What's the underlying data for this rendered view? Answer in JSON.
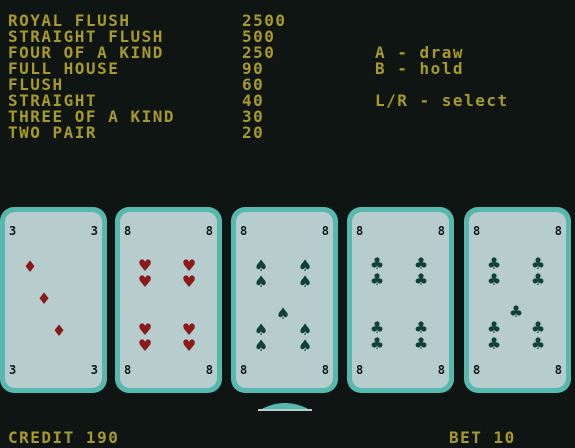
{
  "paytable": [
    {
      "hand": "ROYAL FLUSH",
      "payout": "2500"
    },
    {
      "hand": "STRAIGHT FLUSH",
      "payout": "500"
    },
    {
      "hand": "FOUR OF A KIND",
      "payout": "250"
    },
    {
      "hand": "FULL HOUSE",
      "payout": "90"
    },
    {
      "hand": "FLUSH",
      "payout": "60"
    },
    {
      "hand": "STRAIGHT",
      "payout": "40"
    },
    {
      "hand": "THREE OF A KIND",
      "payout": "30"
    },
    {
      "hand": "TWO PAIR",
      "payout": "20"
    }
  ],
  "controls": {
    "draw": "A - draw",
    "hold": "B - hold",
    "select": "L/R - select"
  },
  "cards": [
    {
      "rank": "3",
      "suit": "diamonds",
      "color": "red"
    },
    {
      "rank": "8",
      "suit": "hearts",
      "color": "red"
    },
    {
      "rank": "8",
      "suit": "spades",
      "color": "black"
    },
    {
      "rank": "8",
      "suit": "clubs",
      "color": "black"
    },
    {
      "rank": "8",
      "suit": "clubs",
      "color": "black"
    }
  ],
  "selected_card_index": 2,
  "status": {
    "credit": "CREDIT 190",
    "bet": "BET 10"
  },
  "colors": {
    "background": "#0e1513",
    "text": "#a89a2a",
    "card_border": "#57b9ae",
    "card_face": "#b7cccc",
    "red_suit": "#8a1a1a",
    "black_suit": "#10403a"
  }
}
